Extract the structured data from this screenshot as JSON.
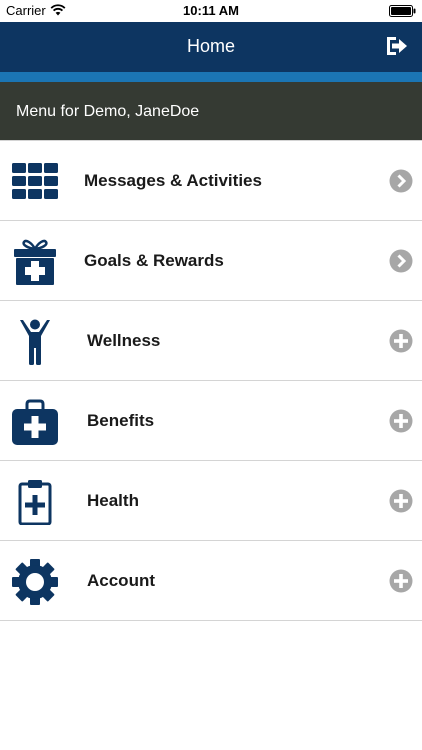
{
  "status_bar": {
    "carrier": "Carrier",
    "time": "10:11 AM"
  },
  "nav_bar": {
    "title": "Home",
    "logout_icon": "logout-icon"
  },
  "menu_header": {
    "text": "Menu for Demo, JaneDoe"
  },
  "menu": {
    "items": [
      {
        "label": "Messages & Activities",
        "icon": "grid-icon",
        "action": "chevron-right"
      },
      {
        "label": "Goals & Rewards",
        "icon": "gift-icon",
        "action": "chevron-right"
      },
      {
        "label": "Wellness",
        "icon": "person-icon",
        "action": "expand-plus"
      },
      {
        "label": "Benefits",
        "icon": "medical-bag-icon",
        "action": "expand-plus"
      },
      {
        "label": "Health",
        "icon": "clipboard-plus-icon",
        "action": "expand-plus"
      },
      {
        "label": "Account",
        "icon": "gear-icon",
        "action": "expand-plus"
      }
    ]
  },
  "colors": {
    "nav_background": "#0d3561",
    "accent_strip": "#1b75b4",
    "header_background": "#353a33",
    "icon_color": "#0d3561",
    "action_icon_color": "#a7a7a7"
  }
}
